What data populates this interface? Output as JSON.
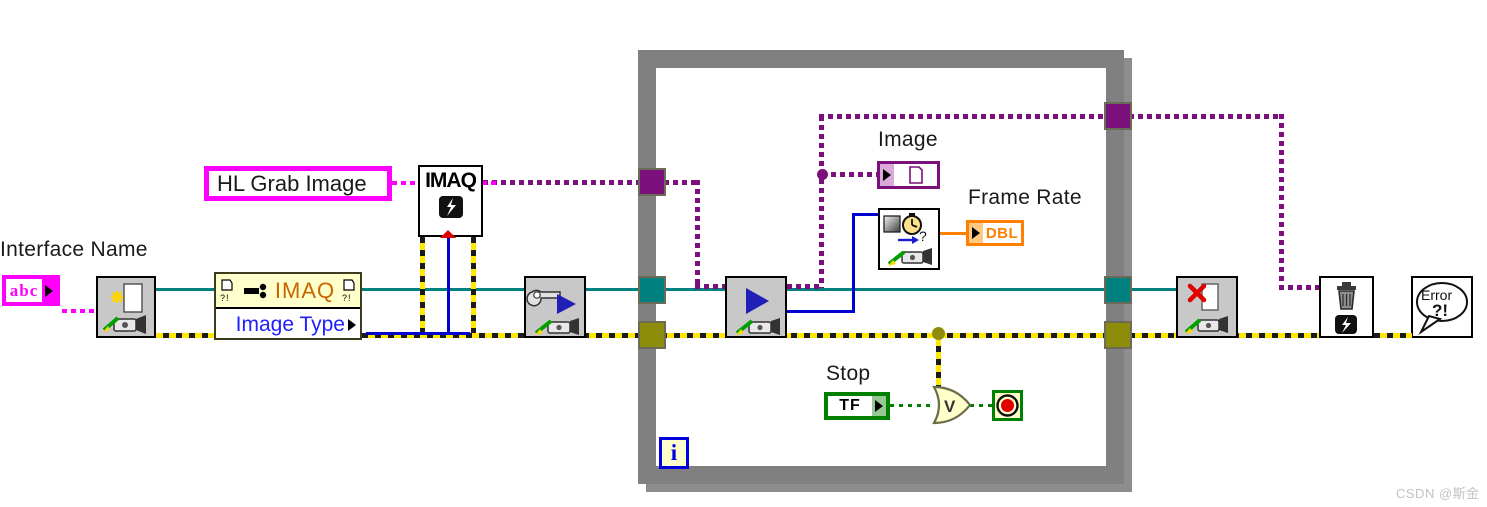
{
  "diagram": {
    "title": "LabVIEW Block Diagram - IMAQdx Grab Image",
    "background": "#ffffff"
  },
  "labels": {
    "interface_name": "Interface Name",
    "hl_grab_image": "HL Grab Image",
    "image": "Image",
    "frame_rate": "Frame Rate",
    "stop": "Stop",
    "image_type": "Image Type",
    "imaq": "IMAQ",
    "iteration": "i"
  },
  "terminals": {
    "interface_name_value": "abc",
    "frame_rate_type": "DBL",
    "stop_value": "TF"
  },
  "nodes": [
    {
      "name": "imaqdx-open-camera",
      "label": "",
      "icon": "open-camera-icon"
    },
    {
      "name": "imaq-create",
      "label": "IMAQ",
      "icon": "imaq-create-icon"
    },
    {
      "name": "imaqdx-property-node",
      "label": "IMAQ",
      "icon": "property-node-icon"
    },
    {
      "name": "imaqdx-configure-grab",
      "label": "",
      "icon": "configure-grab-icon"
    },
    {
      "name": "imaqdx-grab",
      "label": "",
      "icon": "grab-icon"
    },
    {
      "name": "imaqdx-frame-rate",
      "label": "",
      "icon": "frame-rate-icon"
    },
    {
      "name": "imaqdx-close-camera",
      "label": "",
      "icon": "close-camera-icon"
    },
    {
      "name": "imaq-dispose",
      "label": "",
      "icon": "dispose-icon"
    },
    {
      "name": "simple-error-handler",
      "label": "Error ?!",
      "icon": "error-handler-icon"
    },
    {
      "name": "or-gate",
      "label": "",
      "icon": "or-gate-icon"
    },
    {
      "name": "stop-terminal",
      "label": "",
      "icon": "stop-icon"
    }
  ],
  "wire_colors": {
    "image_reference": "#7b0f7b",
    "session_reference": "#00807f",
    "error_cluster": "#ffe800",
    "numeric_dbl": "#ff7f00",
    "string": "#ff00ff",
    "image_type_enum": "#0000d0",
    "boolean": "#008000"
  },
  "structure": {
    "type": "while-loop",
    "border_color": "#808080"
  },
  "watermark": "CSDN @斯金"
}
